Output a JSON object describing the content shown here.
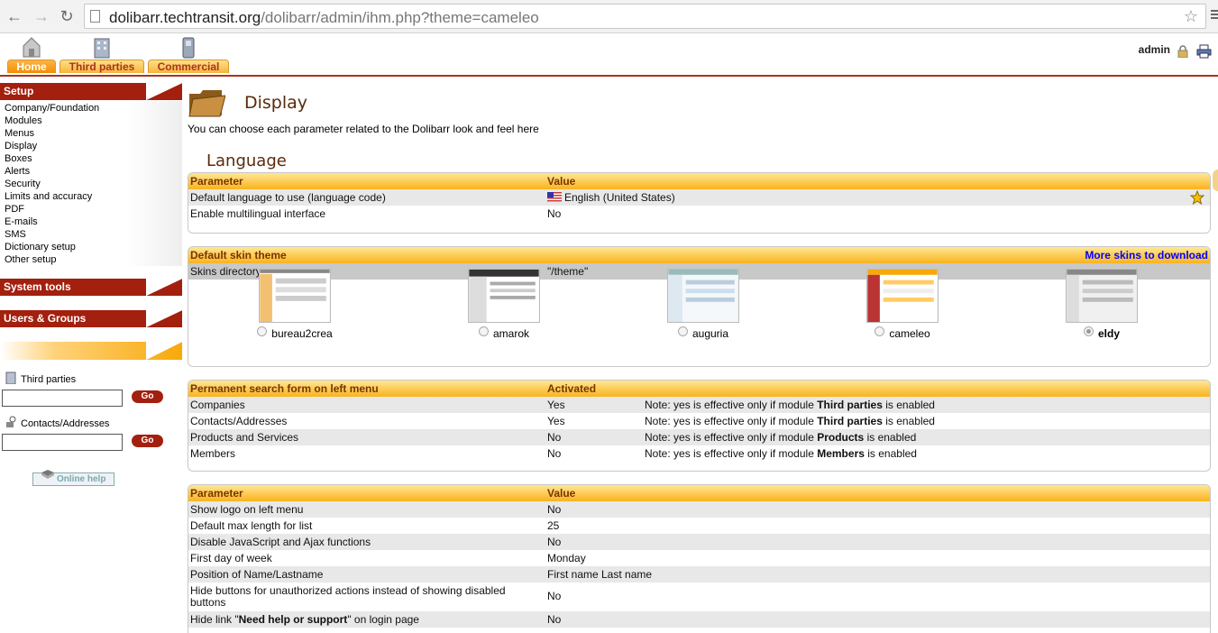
{
  "browser": {
    "url_host": "dolibarr.techtransit.org",
    "url_path": "/dolibarr/admin/ihm.php?theme=cameleo"
  },
  "top_tabs": [
    {
      "label": "Home",
      "active": true
    },
    {
      "label": "Third parties",
      "active": false
    },
    {
      "label": "Commercial",
      "active": false
    }
  ],
  "user": "admin",
  "left_menu": {
    "setup_title": "Setup",
    "setup_items": [
      "Company/Foundation",
      "Modules",
      "Menus",
      "Display",
      "Boxes",
      "Alerts",
      "Security",
      "Limits and accuracy",
      "PDF",
      "E-mails",
      "SMS",
      "Dictionary setup",
      "Other setup"
    ],
    "system_tools": "System tools",
    "users_groups": "Users & Groups",
    "search_thirdparties_label": "Third parties",
    "search_contacts_label": "Contacts/Addresses",
    "go_label": "Go",
    "online_help": "Online help"
  },
  "main": {
    "title": "Display",
    "description": "You can choose each parameter related to the Dolibarr look and feel here",
    "language_section": "Language",
    "lang_table": {
      "headers": [
        "Parameter",
        "Value"
      ],
      "rows": [
        {
          "param": "Default language to use (language code)",
          "value": "English (United States)"
        },
        {
          "param": "Enable multilingual interface",
          "value": "No"
        }
      ]
    },
    "skin_table": {
      "header": "Default skin theme",
      "more_link": "More skins to download",
      "dir_label": "Skins directory",
      "dir_value": "\"/theme\"",
      "skins": [
        {
          "name": "bureau2crea",
          "selected": false
        },
        {
          "name": "amarok",
          "selected": false
        },
        {
          "name": "auguria",
          "selected": false
        },
        {
          "name": "cameleo",
          "selected": false
        },
        {
          "name": "eldy",
          "selected": true
        }
      ]
    },
    "search_table": {
      "headers": [
        "Permanent search form on left menu",
        "Activated"
      ],
      "note_prefix": "Note: yes is effective only if module",
      "note_suffix": "is enabled",
      "rows": [
        {
          "param": "Companies",
          "value": "Yes",
          "module": "Third parties"
        },
        {
          "param": "Contacts/Addresses",
          "value": "Yes",
          "module": "Third parties"
        },
        {
          "param": "Products and Services",
          "value": "No",
          "module": "Products"
        },
        {
          "param": "Members",
          "value": "No",
          "module": "Members"
        }
      ]
    },
    "misc_table": {
      "headers": [
        "Parameter",
        "Value"
      ],
      "rows": [
        {
          "param": "Show logo on left menu",
          "value": "No"
        },
        {
          "param": "Default max length for list",
          "value": "25"
        },
        {
          "param": "Disable JavaScript and Ajax functions",
          "value": "No"
        },
        {
          "param": "First day of week",
          "value": "Monday"
        },
        {
          "param": "Position of Name/Lastname",
          "value": "First name Last name"
        },
        {
          "param": "Hide buttons for unauthorized actions instead of showing disabled buttons",
          "value": "No"
        }
      ],
      "last_row": {
        "prefix": "Hide link \"",
        "bold": "Need help or support",
        "suffix": "\" on login page",
        "value": "No"
      }
    }
  }
}
